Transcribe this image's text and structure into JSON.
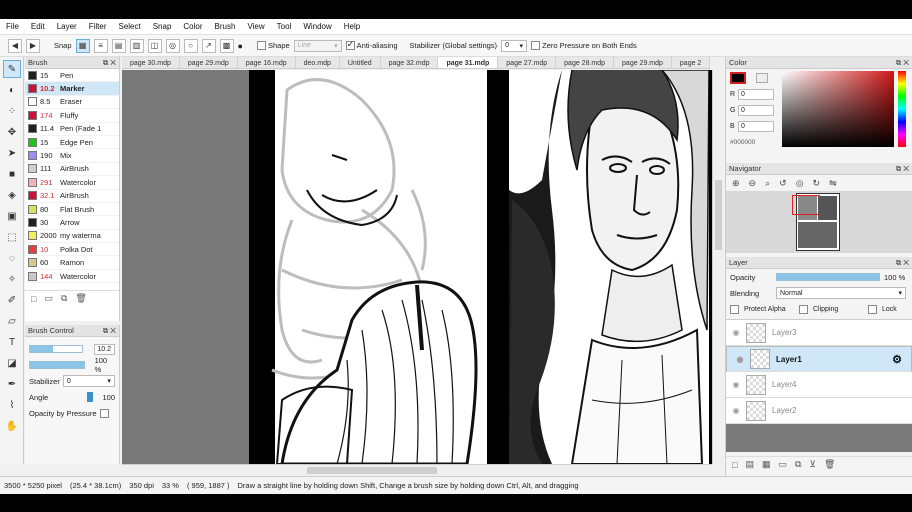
{
  "menu": [
    "File",
    "Edit",
    "Layer",
    "Filter",
    "Select",
    "Snap",
    "Color",
    "Brush",
    "View",
    "Tool",
    "Window",
    "Help"
  ],
  "toolbar": {
    "snap_label": "Snap",
    "shape_label": "Shape",
    "shape_value": "Line",
    "antialias_label": "Anti-aliasing",
    "stabilizer_label": "Stabilizer (Global settings)",
    "stabilizer_value": "0",
    "zero_pressure_label": "Zero Pressure on Both Ends"
  },
  "brush_panel": {
    "title": "Brush",
    "items": [
      {
        "size": "15",
        "name": "Pen",
        "color": "#202020"
      },
      {
        "size": "10.2",
        "name": "Marker",
        "color": "#c8143c",
        "selected": true
      },
      {
        "size": "8.5",
        "name": "Eraser",
        "color": "#ffffff"
      },
      {
        "size": "174",
        "name": "Fluffy",
        "color": "#c8143c"
      },
      {
        "size": "11.4",
        "name": "Pen (Fade 1",
        "color": "#202020"
      },
      {
        "size": "15",
        "name": "Edge Pen",
        "color": "#19c819"
      },
      {
        "size": "190",
        "name": "Mix",
        "color": "#a08cf0"
      },
      {
        "size": "111",
        "name": "AirBrush",
        "color": "#d0d0d0"
      },
      {
        "size": "291",
        "name": "Watercolor",
        "color": "#f0b4b4"
      },
      {
        "size": "32.1",
        "name": "AirBrush",
        "color": "#c8143c"
      },
      {
        "size": "80",
        "name": "Flat Brush",
        "color": "#d8e060"
      },
      {
        "size": "30",
        "name": "Arrow",
        "color": "#202020"
      },
      {
        "size": "2000",
        "name": "my waterma",
        "color": "#f0f060"
      },
      {
        "size": "10",
        "name": "Polka Dot",
        "color": "#e04040"
      },
      {
        "size": "60",
        "name": "Ramon",
        "color": "#d8c890"
      },
      {
        "size": "144",
        "name": "Watercolor",
        "color": "#c8c8c8"
      }
    ]
  },
  "brush_control": {
    "title": "Brush Control",
    "size_value": "10.2",
    "size_fraction": 0.45,
    "opacity_value": "100 %",
    "stabilizer_label": "Stabilizer",
    "stabilizer_value": "0",
    "angle_label": "Angle",
    "angle_value": "100",
    "opacity_by_pressure_label": "Opacity by Pressure"
  },
  "tabs": [
    {
      "label": "page 30.mdp"
    },
    {
      "label": "page 29.mdp"
    },
    {
      "label": "page 16.mdp"
    },
    {
      "label": "deo.mdp"
    },
    {
      "label": "Untitled"
    },
    {
      "label": "page 32.mdp"
    },
    {
      "label": "page 31.mdp",
      "active": true
    },
    {
      "label": "page 27.mdp"
    },
    {
      "label": "page 28.mdp"
    },
    {
      "label": "page 29.mdp"
    },
    {
      "label": "page 2"
    }
  ],
  "color_panel": {
    "title": "Color",
    "r_label": "R",
    "r": "0",
    "g_label": "G",
    "g": "0",
    "b_label": "B",
    "b": "0",
    "hex": "#000000",
    "current": "#000000"
  },
  "navigator": {
    "title": "Navigator"
  },
  "layer_panel": {
    "title": "Layer",
    "opacity_label": "Opacity",
    "opacity_value": "100 %",
    "opacity_fraction": 1.0,
    "blending_label": "Blending",
    "blending_value": "Normal",
    "protect_alpha_label": "Protect Alpha",
    "clipping_label": "Clipping",
    "lock_label": "Lock",
    "layers": [
      {
        "name": "Layer3"
      },
      {
        "name": "Layer1",
        "selected": true
      },
      {
        "name": "Layer4"
      },
      {
        "name": "Layer2"
      }
    ]
  },
  "status": {
    "dimensions": "3500 * 5250 pixel",
    "physical": "(25.4 * 38.1cm)",
    "dpi": "350 dpi",
    "zoom": "33 %",
    "coords": "( 959, 1887 )",
    "hint": "Draw a straight line by holding down Shift, Change a brush size by holding down Ctrl, Alt, and dragging"
  }
}
